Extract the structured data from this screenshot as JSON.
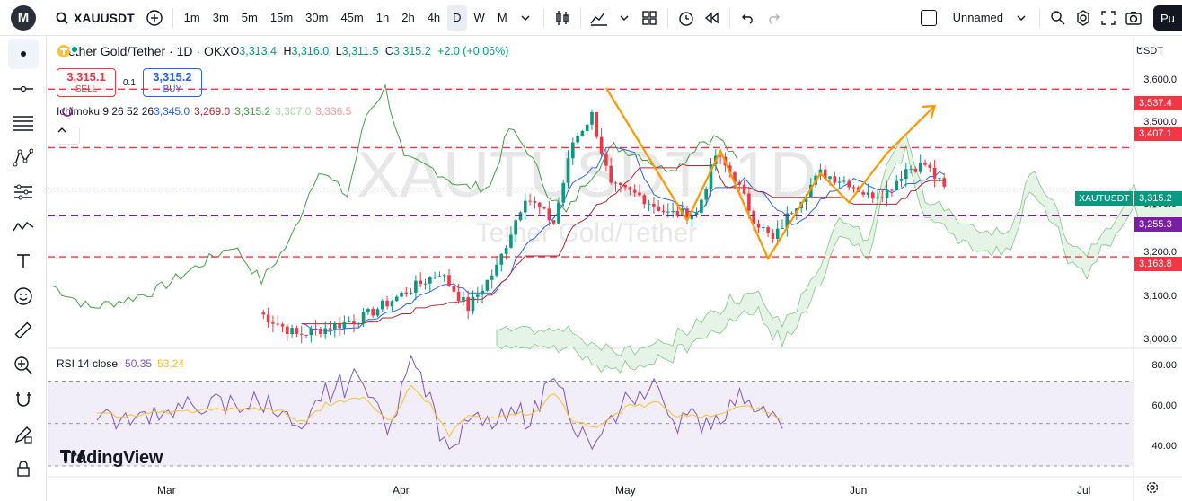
{
  "toolbar": {
    "logo": "M",
    "symbol": "XAUUSDT",
    "intervals": [
      "1m",
      "3m",
      "5m",
      "15m",
      "30m",
      "45m",
      "1h",
      "2h",
      "4h",
      "D",
      "W",
      "M"
    ],
    "active_interval": "D",
    "layout_name": "Unnamed",
    "publish_label": "Pu"
  },
  "legend": {
    "title": "Tether Gold/Tether · 1D · OKX",
    "open_label": "O",
    "open": "3,313.4",
    "high_label": "H",
    "high": "3,316.0",
    "low_label": "L",
    "low": "3,311.5",
    "close_label": "C",
    "close": "3,315.2",
    "change": "+2.0 (+0.06%)",
    "sell_price": "3,315.1",
    "sell_label": "SELL",
    "spread": "0.1",
    "buy_price": "3,315.2",
    "buy_label": "BUY"
  },
  "ichimoku": {
    "label": "Ichimoku 9 26 52 26",
    "v1": "3,345.0",
    "v2": "3,269.0",
    "v3": "3,315.2",
    "v4": "3,307.0",
    "v5": "3,336.5"
  },
  "rsi": {
    "label": "RSI 14 close",
    "v1": "50.35",
    "v2": "53.24"
  },
  "watermark": {
    "symbol": "XAUTUSDT, 1D",
    "name": "Tether Gold/Tether"
  },
  "branding": "TradingView",
  "price_axis": {
    "currency": "USDT",
    "ticks": [
      "3,600.0",
      "3,500.0",
      "3,300.0",
      "3,200.0",
      "3,100.0",
      "3,000.0"
    ],
    "tags": {
      "level1": "3,537.4",
      "level2": "3,407.1",
      "symbol_tag": "XAUTUSDT",
      "current": "3,315.2",
      "level3": "3,255.3",
      "level4": "3,163.8"
    },
    "rsi_ticks": [
      "80.00",
      "60.00",
      "40.00"
    ]
  },
  "time_axis": {
    "months": [
      "Mar",
      "Apr",
      "May",
      "Jun",
      "Jul"
    ]
  },
  "colors": {
    "up": "#089981",
    "down": "#f23645",
    "accent": "#2962ff",
    "level": "#f23645",
    "arrow": "#ff9800",
    "purple": "#7b1fa2"
  },
  "chart_data": {
    "type": "candlestick",
    "price_range": [
      2960,
      3640
    ],
    "levels": [
      3537.4,
      3407.1,
      3255.3,
      3163.8
    ],
    "rsi_range": [
      30,
      85
    ],
    "rsi_bands": [
      70,
      50,
      30
    ]
  }
}
